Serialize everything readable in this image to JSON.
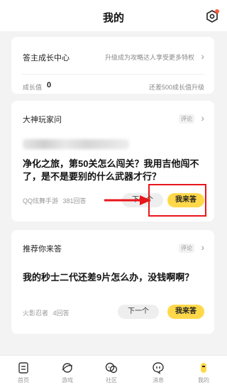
{
  "header": {
    "title": "我的"
  },
  "growth": {
    "center_label": "答主成长中心",
    "center_hint": "升级成为攻略达人享受更多特权",
    "level_label": "成长值",
    "level_value": "0",
    "level_hint": "还差500成长值升级"
  },
  "questions": [
    {
      "section_title": "大神玩家问",
      "badge": "评论",
      "text": "净化之旅，第50关怎么闯关？我用吉他闯不了，是不是要别的什么武器才行？",
      "game": "QQ炫舞手游",
      "answers": "381回答",
      "next_label": "下一个",
      "answer_label": "我来答"
    },
    {
      "section_title": "推荐你来答",
      "badge": "评论",
      "text": "我的秒士二代还差9片怎么办，没钱啊啊？",
      "game": "火影忍者",
      "answers": "4回答",
      "next_label": "下一个",
      "answer_label": "我来答"
    }
  ],
  "tabbar": [
    {
      "label": "首页",
      "icon": "doc-icon"
    },
    {
      "label": "游戏",
      "icon": "planet-icon"
    },
    {
      "label": "社区",
      "icon": "chat-group-icon"
    },
    {
      "label": "消息",
      "icon": "message-icon"
    },
    {
      "label": "我的",
      "icon": "profile-icon"
    }
  ],
  "colors": {
    "accent": "#ffd84a",
    "highlight": "#e8151a"
  }
}
